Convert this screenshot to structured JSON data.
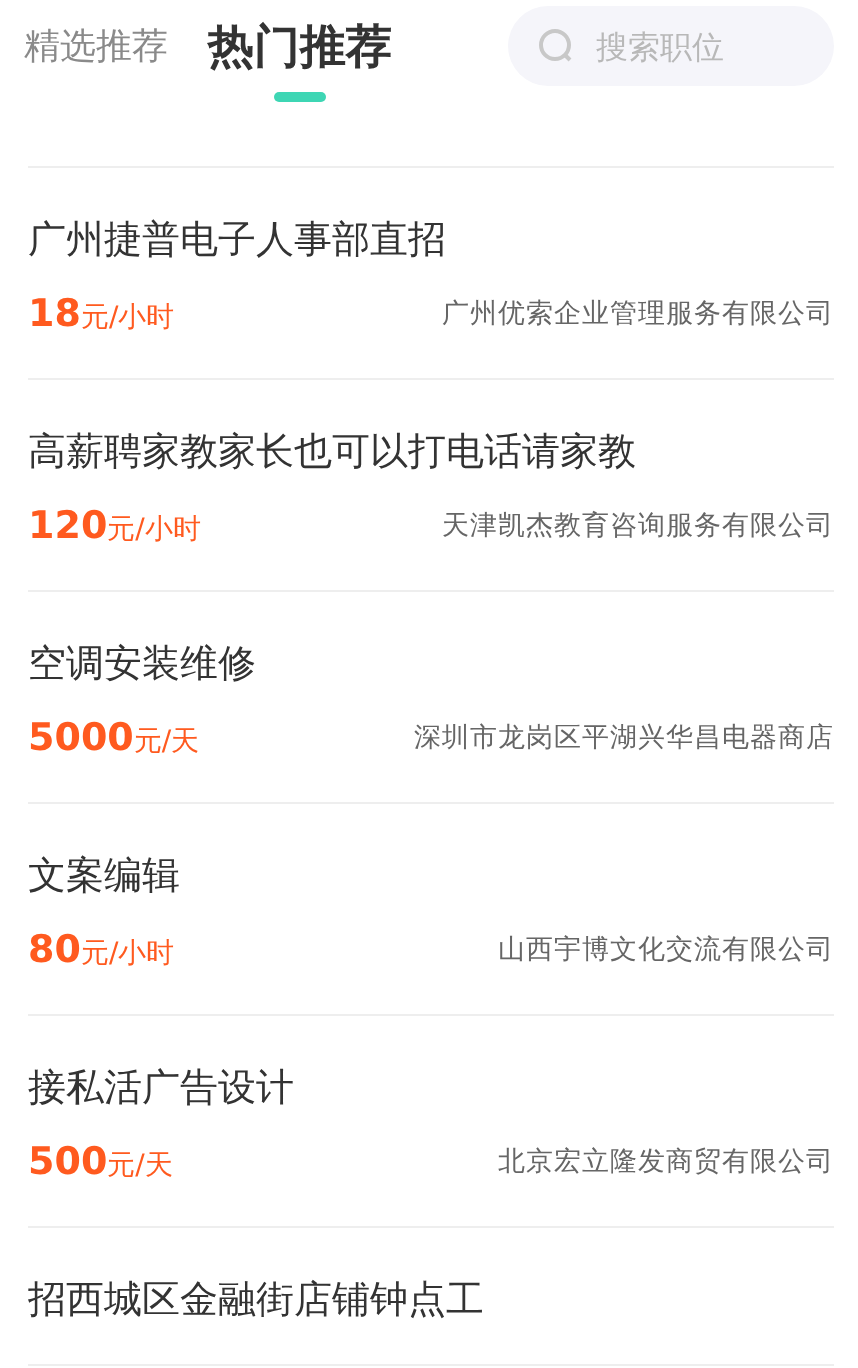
{
  "tabs": [
    {
      "label": "精选推荐",
      "selected": false
    },
    {
      "label": "热门推荐",
      "selected": true
    }
  ],
  "search": {
    "placeholder": "搜索职位"
  },
  "jobs": [
    {
      "title": "广州捷普电子人事部直招",
      "salary": "18",
      "unit": "元/小时",
      "company": "广州优索企业管理服务有限公司"
    },
    {
      "title": "高薪聘家教家长也可以打电话请家教",
      "salary": "120",
      "unit": "元/小时",
      "company": "天津凯杰教育咨询服务有限公司"
    },
    {
      "title": "空调安装维修",
      "salary": "5000",
      "unit": "元/天",
      "company": "深圳市龙岗区平湖兴华昌电器商店"
    },
    {
      "title": "文案编辑",
      "salary": "80",
      "unit": "元/小时",
      "company": "山西宇博文化交流有限公司"
    },
    {
      "title": "接私活广告设计",
      "salary": "500",
      "unit": "元/天",
      "company": "北京宏立隆发商贸有限公司"
    },
    {
      "title": "招西城区金融街店铺钟点工"
    }
  ]
}
